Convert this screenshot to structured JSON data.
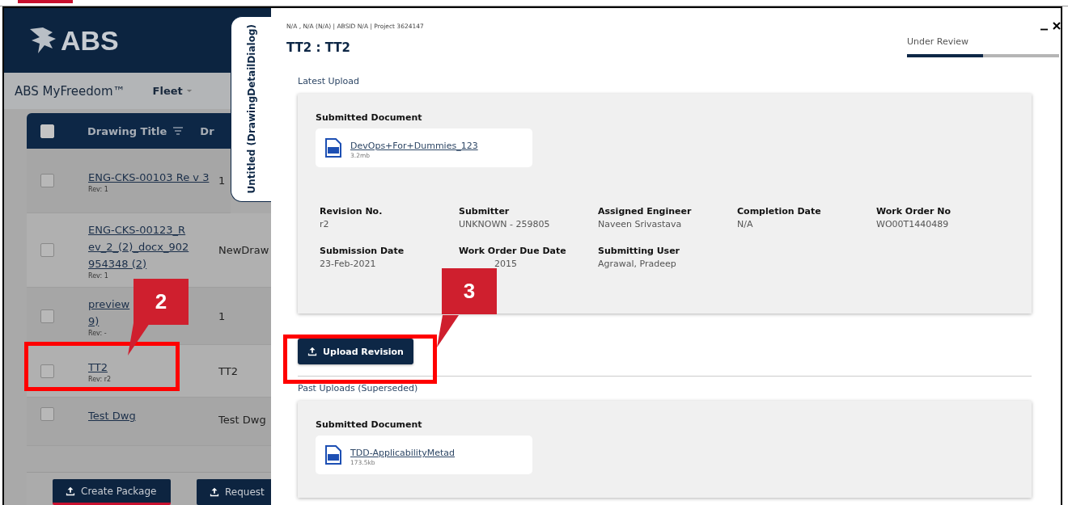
{
  "app": {
    "logo_text": "ABS",
    "product": "ABS MyFreedom™",
    "nav": [
      {
        "label": "Fleet"
      }
    ]
  },
  "table": {
    "select_all_checked": false,
    "columns": [
      "Drawing Title",
      "Dr"
    ],
    "rows": [
      {
        "title_parts": [
          "ENG-CKS-00103 Re v 3"
        ],
        "rev": "Rev: 1",
        "column_2": "1",
        "checked": false
      },
      {
        "title_parts": [
          "ENG-CKS-00123_R ev_2_(2)_docx_902 954348 (2)"
        ],
        "rev": "Rev: 1",
        "column_2": "NewDraw",
        "checked": false
      },
      {
        "title_parts": [
          "preview",
          "9)"
        ],
        "rev": "Rev: -",
        "column_2": "1",
        "checked": false
      },
      {
        "title_parts": [
          "TT2"
        ],
        "rev": "Rev: r2",
        "column_2": "TT2",
        "checked": false
      },
      {
        "title_parts": [
          "Test Dwg"
        ],
        "column_2": "Test Dwg",
        "checked": false
      }
    ]
  },
  "footer_buttons": [
    {
      "label": "Create Package"
    },
    {
      "label": "Request"
    }
  ],
  "side_tab": {
    "label": "Untitled (DrawingDetailDialog)"
  },
  "dialog": {
    "breadcrumb": "N/A , N/A (N/A) | ABSID N/A | Project 3624147",
    "title": "TT2 : TT2",
    "status": {
      "label": "Under Review",
      "level": 0.5
    },
    "latest": {
      "heading": "Latest Upload",
      "doc_heading": "Submitted Document",
      "file": {
        "name": "DevOps+For+Dummies_123",
        "size": "3.2mb"
      },
      "fields": [
        {
          "label": "Revision No.",
          "value": "r2"
        },
        {
          "label": "Submitter",
          "value": "UNKNOWN - 259805"
        },
        {
          "label": "Assigned Engineer",
          "value": "Naveen Srivastava"
        },
        {
          "label": "Completion Date",
          "value": "N/A"
        },
        {
          "label": "Work Order No",
          "value": "WO00T1440489"
        },
        {
          "label": "Submission Date",
          "value": "23-Feb-2021"
        },
        {
          "label": "Work Order Due Date",
          "value": "2015",
          "covered": true
        },
        {
          "label": "Submitting User",
          "value": "Agrawal, Pradeep"
        }
      ]
    },
    "upload_button": "Upload Revision",
    "past": {
      "heading": "Past Uploads (Superseded)",
      "doc_heading": "Submitted Document",
      "file": {
        "name": "TDD-ApplicabilityMetad",
        "size": "173.5kb"
      }
    }
  },
  "callouts": [
    {
      "number": "2"
    },
    {
      "number": "3"
    }
  ]
}
